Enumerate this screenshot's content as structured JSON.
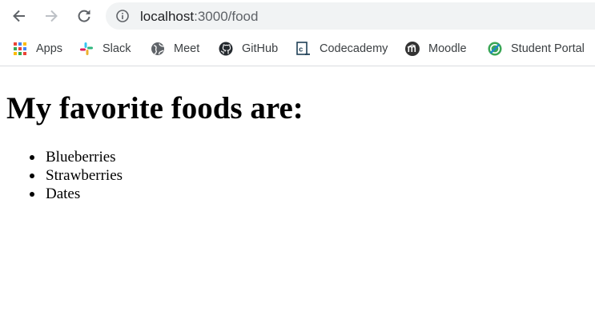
{
  "browser": {
    "url_host": "localhost",
    "url_path": ":3000/food"
  },
  "bookmarks": [
    {
      "label": "Apps",
      "icon": "apps-grid-icon"
    },
    {
      "label": "Slack",
      "icon": "slack-icon"
    },
    {
      "label": "Meet",
      "icon": "globe-icon"
    },
    {
      "label": "GitHub",
      "icon": "github-icon"
    },
    {
      "label": "Codecademy",
      "icon": "codecademy-icon"
    },
    {
      "label": "Moodle",
      "icon": "moodle-icon"
    },
    {
      "label": "Student Portal",
      "icon": "student-portal-icon"
    }
  ],
  "page": {
    "title": "My favorite foods are:",
    "foods": [
      "Blueberries",
      "Strawberries",
      "Dates"
    ]
  },
  "colors": {
    "omnibox_bg": "#f1f3f4",
    "chrome_icon": "#5f6368",
    "disabled_icon": "#bdc1c6"
  }
}
